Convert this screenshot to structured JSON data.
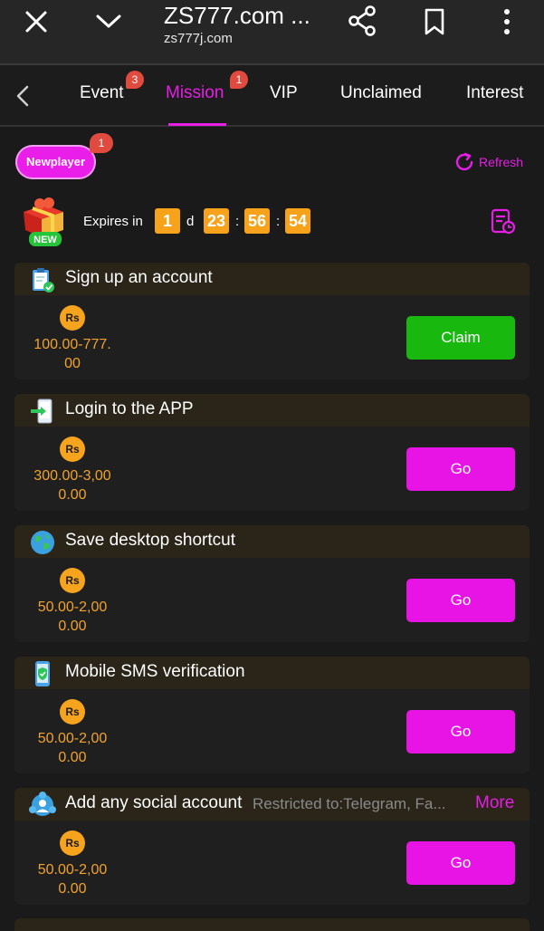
{
  "browser": {
    "title": "ZS777.com ...",
    "url": "zs777j.com"
  },
  "tabs": [
    {
      "label": "Event",
      "badge": "3"
    },
    {
      "label": "Mission",
      "badge": "1",
      "active": true
    },
    {
      "label": "VIP"
    },
    {
      "label": "Unclaimed"
    },
    {
      "label": "Interest"
    }
  ],
  "header": {
    "newplayer_label": "Newplayer",
    "newplayer_badge": "1",
    "refresh_label": "Refresh",
    "gift_label": "NEW"
  },
  "countdown": {
    "label": "Expires in",
    "days": "1",
    "day_unit": "d",
    "hours": "23",
    "minutes": "56",
    "seconds": "54",
    "separator": ":"
  },
  "coin_label": "Rs",
  "missions": [
    {
      "title": "Sign up an account",
      "reward_line1": "100.00-777.",
      "reward_line2": "00",
      "button": "Claim",
      "icon": "clipboard-check-icon"
    },
    {
      "title": "Login to the APP",
      "reward_line1": "300.00-3,00",
      "reward_line2": "0.00",
      "button": "Go",
      "icon": "phone-login-icon"
    },
    {
      "title": "Save desktop shortcut",
      "reward_line1": "50.00-2,00",
      "reward_line2": "0.00",
      "button": "Go",
      "icon": "globe-icon"
    },
    {
      "title": "Mobile SMS verification",
      "reward_line1": "50.00-2,00",
      "reward_line2": "0.00",
      "button": "Go",
      "icon": "phone-shield-icon"
    },
    {
      "title": "Add any social account",
      "subtitle": "Restricted to:Telegram, Fa...",
      "more": "More",
      "reward_line1": "50.00-2,00",
      "reward_line2": "0.00",
      "button": "Go",
      "icon": "social-network-icon"
    }
  ],
  "colors": {
    "accent": "#e61ee6",
    "claim": "#19b80f",
    "countdown": "#f7a21b",
    "reward": "#f1a32c"
  }
}
